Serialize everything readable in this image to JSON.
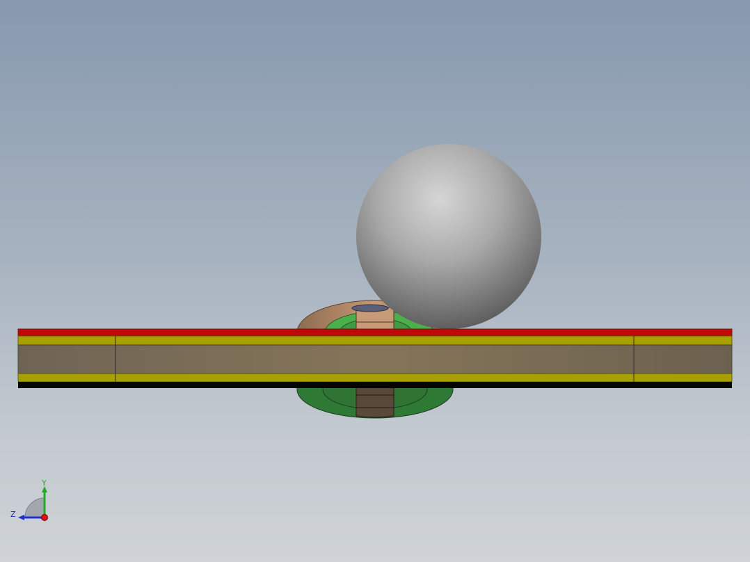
{
  "viewport": {
    "name": "3d-model-viewport"
  },
  "triad": {
    "y_label": "Y",
    "z_label": "Z",
    "colors": {
      "y_axis": "#22aa22",
      "z_axis": "#2233cc",
      "x_axis": "#dd1111"
    }
  },
  "model": {
    "colors": {
      "sphere": "#b5b5b5",
      "plate_top": "#c00a0a",
      "plate_layer": "#a8a000",
      "plate_core": "#857558",
      "ring_copper": "#b98a66",
      "ring_green": "#4bb04b",
      "ring_dark_green": "#2e7a35",
      "bottom_edge": "#000000"
    }
  }
}
